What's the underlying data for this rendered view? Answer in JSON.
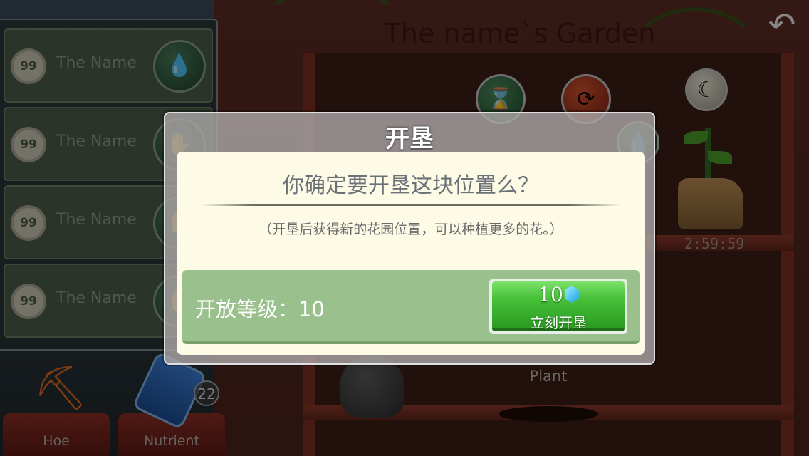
{
  "scene": {
    "garden_title": "The name`s Garden",
    "timer": "2:59:59",
    "plant_label": "Plant",
    "back_icon": "back-arrow-icon"
  },
  "friends": [
    {
      "level": "99",
      "name": "The Name",
      "icon": "water-drop-icon"
    },
    {
      "level": "99",
      "name": "The Name",
      "icon": "glove-icon"
    },
    {
      "level": "99",
      "name": "The Name",
      "icon": "glove-icon"
    },
    {
      "level": "99",
      "name": "The Name",
      "icon": "glove-icon"
    }
  ],
  "items": {
    "hoe_label": "Hoe",
    "nutrient_label": "Nutrient",
    "nutrient_count": "22"
  },
  "dialog": {
    "title": "开垦",
    "question": "你确定要开垦这块位置么？",
    "note": "（开垦后获得新的花园位置，可以种植更多的花。）",
    "level_text": "开放等级：10",
    "cost": "10",
    "button_label": "立刻开垦"
  },
  "colors": {
    "button_green": "#49c23a",
    "dialog_body": "#fdfbe6",
    "footer_green": "#9ac08e"
  }
}
